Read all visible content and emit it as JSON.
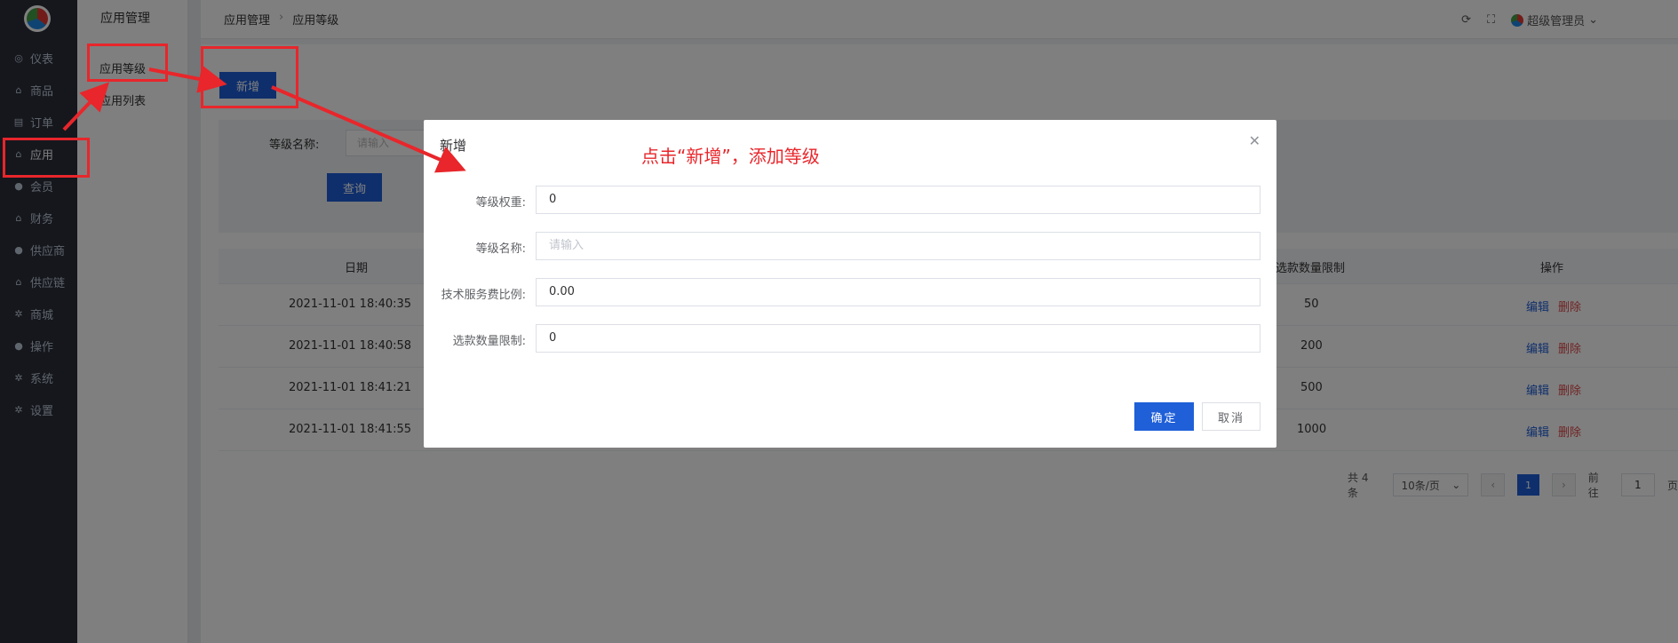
{
  "nav": {
    "items": [
      {
        "label": "仪表",
        "icon": "dashboard-icon"
      },
      {
        "label": "商品",
        "icon": "bag-icon"
      },
      {
        "label": "订单",
        "icon": "clipboard-icon"
      },
      {
        "label": "应用",
        "icon": "bag-icon"
      },
      {
        "label": "会员",
        "icon": "user-icon"
      },
      {
        "label": "财务",
        "icon": "bag-icon"
      },
      {
        "label": "供应商",
        "icon": "user-icon"
      },
      {
        "label": "供应链",
        "icon": "bag-icon"
      },
      {
        "label": "商城",
        "icon": "gear-icon"
      },
      {
        "label": "操作",
        "icon": "user-icon"
      },
      {
        "label": "系统",
        "icon": "gear-icon"
      },
      {
        "label": "设置",
        "icon": "gear-icon"
      }
    ],
    "active": "应用"
  },
  "subnav": {
    "title": "应用管理",
    "items": [
      {
        "label": "应用等级"
      },
      {
        "label": "应用列表"
      }
    ]
  },
  "header": {
    "breadcrumb": [
      "应用管理",
      "应用等级"
    ],
    "user_name": "超级管理员"
  },
  "toolbar": {
    "add_label": "新增"
  },
  "filter": {
    "name_label": "等级名称:",
    "name_placeholder": "请输入",
    "query_label": "查询"
  },
  "table": {
    "headers": {
      "date": "日期",
      "limit": "选款数量限制",
      "ops": "操作"
    },
    "rows": [
      {
        "date": "2021-11-01 18:40:35",
        "limit": "50"
      },
      {
        "date": "2021-11-01 18:40:58",
        "limit": "200"
      },
      {
        "date": "2021-11-01 18:41:21",
        "limit": "500"
      },
      {
        "date": "2021-11-01 18:41:55",
        "limit": "1000"
      }
    ],
    "edit_label": "编辑",
    "delete_label": "删除"
  },
  "pager": {
    "total": "共 4 条",
    "page_size": "10条/页",
    "current": "1",
    "goto_prefix": "前往",
    "goto_value": "1",
    "goto_suffix": "页"
  },
  "dialog": {
    "title": "新增",
    "fields": [
      {
        "label": "等级权重:",
        "value": "0"
      },
      {
        "label": "等级名称:",
        "placeholder": "请输入"
      },
      {
        "label": "技术服务费比例:",
        "value": "0.00"
      },
      {
        "label": "选款数量限制:",
        "value": "0"
      }
    ],
    "ok_label": "确定",
    "cancel_label": "取消"
  },
  "annotation": {
    "text": "点击“新增”，添加等级",
    "color": "#e8262b"
  },
  "colors": {
    "primary": "#1f5fd8",
    "danger": "#e04848",
    "nav_bg": "#2b2f3a"
  }
}
